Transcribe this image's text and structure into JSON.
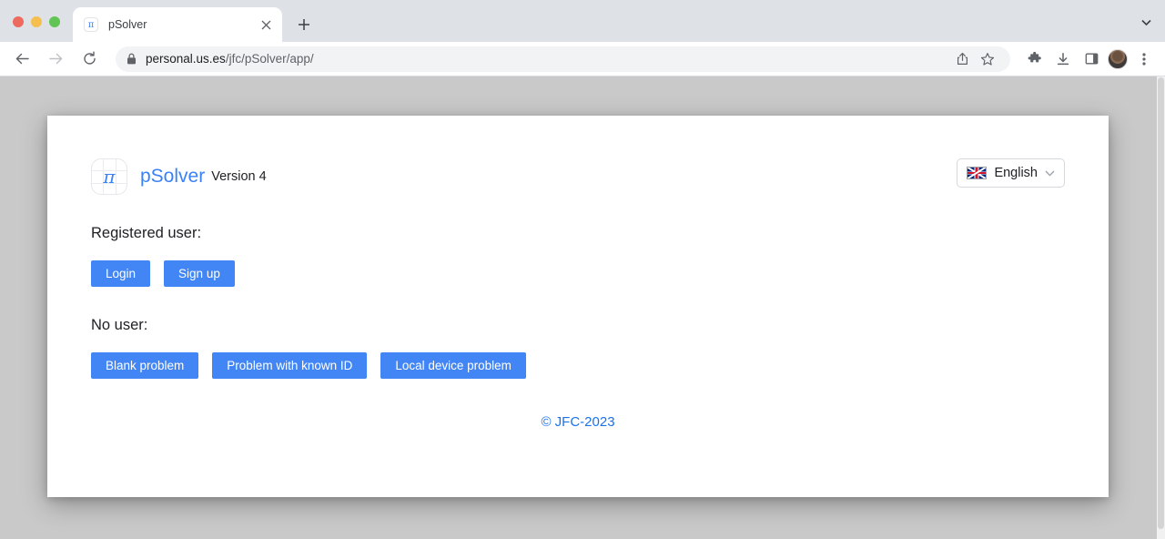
{
  "browser": {
    "window_controls": [
      "close",
      "minimize",
      "zoom"
    ],
    "tab": {
      "title": "pSolver",
      "favicon_glyph": "π",
      "favicon_name": "psolver-favicon",
      "close_glyph": "×"
    },
    "new_tab_label": "+",
    "tab_list_label": "⌄",
    "toolbar": {
      "back_label": "←",
      "forward_label": "→",
      "reload_label": "↻",
      "url_host": "personal.us.es",
      "url_path": "/jfc/pSolver/app/",
      "icons": [
        "share-icon",
        "bookmark-star-icon",
        "extensions-puzzle-icon",
        "downloads-icon",
        "side-panel-icon",
        "profile-avatar",
        "browser-menu-icon"
      ]
    }
  },
  "page": {
    "brand": {
      "logo_glyph": "π",
      "name": "pSolver",
      "version": "Version 4"
    },
    "language": {
      "label": "English",
      "flag": "united-kingdom",
      "chevron": "⌄"
    },
    "sections": [
      {
        "label": "Registered user:",
        "buttons": [
          "Login",
          "Sign up"
        ]
      },
      {
        "label": "No user:",
        "buttons": [
          "Blank problem",
          "Problem with known ID",
          "Local device problem"
        ]
      }
    ],
    "footer": {
      "copyright": "© JFC-2023"
    },
    "colors": {
      "accent_blue": "#4285f4",
      "link_blue": "#1a73e8",
      "page_background": "#c9c9c9",
      "card_background": "#ffffff"
    }
  }
}
